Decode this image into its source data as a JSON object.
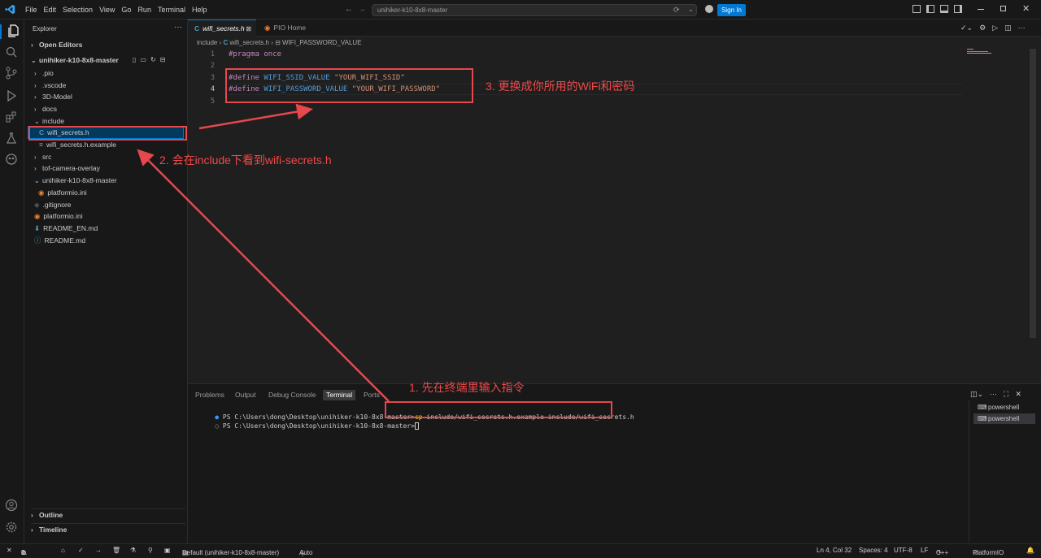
{
  "titlebar": {
    "menu": [
      "File",
      "Edit",
      "Selection",
      "View",
      "Go",
      "Run",
      "Terminal",
      "Help"
    ],
    "search_text": "unihiker-k10-8x8-master",
    "sign_in": "Sign In"
  },
  "sidebar": {
    "title": "Explorer",
    "open_editors": "Open Editors",
    "folder": "unihiker-k10-8x8-master",
    "items": [
      {
        "label": ".pio"
      },
      {
        "label": ".vscode"
      },
      {
        "label": "3D-Model"
      },
      {
        "label": "docs"
      },
      {
        "label": "include"
      },
      {
        "label": "wifi_secrets.h"
      },
      {
        "label": "wifi_secrets.h.example"
      },
      {
        "label": "src"
      },
      {
        "label": "tof-camera-overlay"
      },
      {
        "label": "unihiker-k10-8x8-master"
      },
      {
        "label": "platformio.ini"
      },
      {
        "label": ".gitignore"
      },
      {
        "label": "platformio.ini"
      },
      {
        "label": "README_EN.md"
      },
      {
        "label": "README.md"
      }
    ],
    "outline": "Outline",
    "timeline": "Timeline"
  },
  "editor": {
    "tabs": [
      {
        "label": "wifi_secrets.h"
      },
      {
        "label": "PIO Home"
      }
    ],
    "breadcrumb": {
      "folder": "include",
      "file": "wifi_secrets.h",
      "symbol": "WIFI_PASSWORD_VALUE"
    },
    "lines": [
      {
        "num": "1",
        "kw": "#pragma",
        "name": "once",
        "value": ""
      },
      {
        "num": "2",
        "kw": "",
        "name": "",
        "value": ""
      },
      {
        "num": "3",
        "kw": "#define",
        "name": "WIFI_SSID_VALUE",
        "value": "\"YOUR_WIFI_SSID\""
      },
      {
        "num": "4",
        "kw": "#define",
        "name": "WIFI_PASSWORD_VALUE",
        "value": "\"YOUR_WIFI_PASSWORD\""
      },
      {
        "num": "5",
        "kw": "",
        "name": "",
        "value": ""
      }
    ]
  },
  "panel": {
    "tabs": [
      "Problems",
      "Output",
      "Debug Console",
      "Terminal",
      "Ports"
    ],
    "prompt": "PS C:\\Users\\dong\\Desktop\\unihiker-k10-8x8-master>",
    "cmd_keyword": "cp",
    "cmd_args": "include/wifi_secrets.h.example include/wifi_secrets.h",
    "terminals": [
      "powershell",
      "powershell"
    ]
  },
  "statusbar": {
    "problems": "0",
    "warnings": "0",
    "env": "Default (unihiker-k10-8x8-master)",
    "auto": "Auto",
    "position": "Ln 4, Col 32",
    "spaces": "Spaces: 4",
    "encoding": "UTF-8",
    "eol": "LF",
    "language": "C++",
    "platformio": "PlatformIO"
  },
  "annotations": {
    "step1": "1. 先在终端里输入指令",
    "step2": "2. 会在include下看到wifi-secrets.h",
    "step3": "3. 更换成你所用的WiFi和密码",
    "color": "#e5484d"
  },
  "colors": {
    "accent": "#0078d4",
    "keyword": "#c586c0",
    "macro": "#569cd6",
    "string": "#ce9178",
    "background": "#1f1f1f"
  }
}
